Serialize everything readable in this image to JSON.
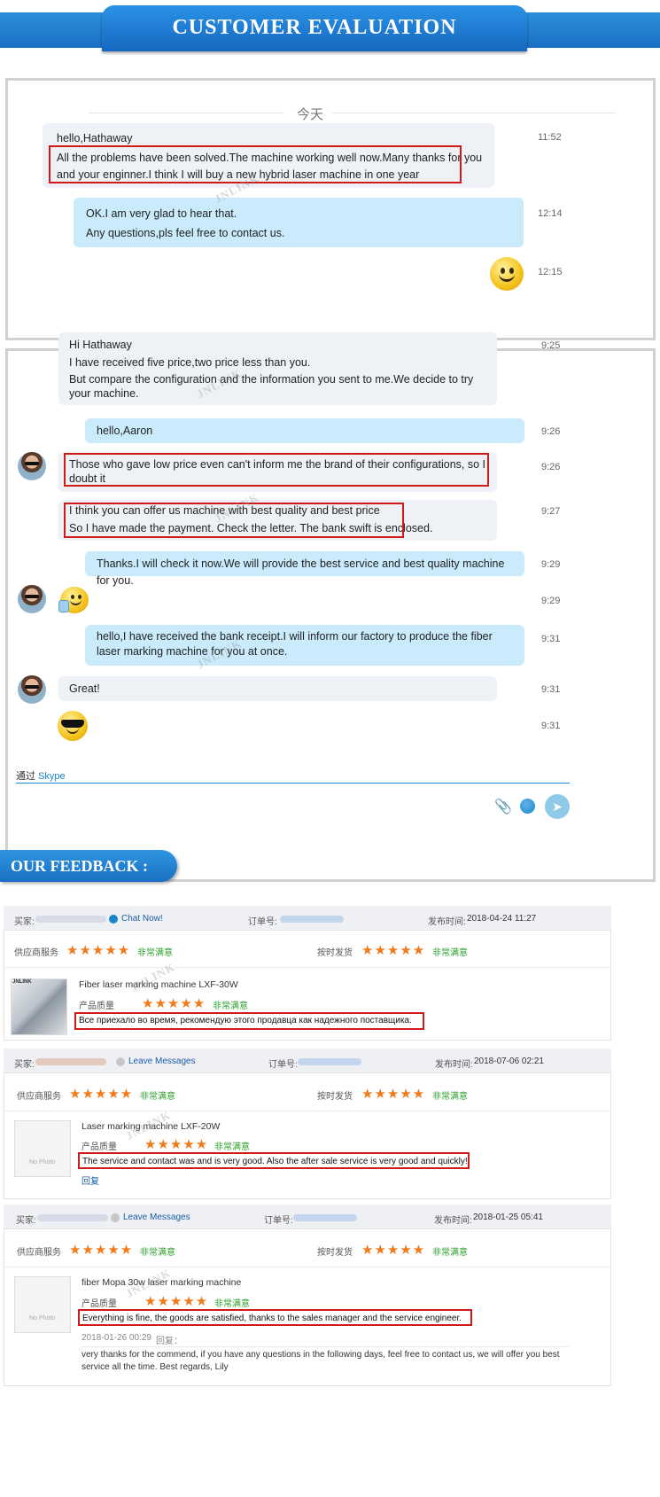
{
  "header": {
    "title": "CUSTOMER EVALUATION"
  },
  "chat1": {
    "date_divider": "今天",
    "messages": [
      {
        "side": "in",
        "lines": [
          "hello,Hathaway",
          "All the problems have been solved.The machine working well now.Many thanks for you and your enginner.I think I will buy a new hybrid laser machine in one year"
        ],
        "time": "11:52"
      },
      {
        "side": "out",
        "lines": [
          "OK.I am very glad to hear that.",
          "Any questions,pls feel free to contact us."
        ],
        "time": "12:14"
      },
      {
        "side": "in",
        "emoji": "smile-icon",
        "time": "12:15"
      }
    ]
  },
  "chat2": {
    "messages": [
      {
        "side": "in",
        "lines": [
          "Hi Hathaway",
          "I have received five price,two price less than you.",
          "But compare the configuration and the information you sent to me.We decide to try your machine."
        ],
        "time": "9:25"
      },
      {
        "side": "out",
        "lines": [
          "hello,Aaron"
        ],
        "time": "9:26"
      },
      {
        "side": "in",
        "lines": [
          "Those who gave low price even can't inform me the brand of their configurations, so I doubt it"
        ],
        "time": "9:26"
      },
      {
        "side": "in",
        "lines": [
          "I think you can offer us machine with best quality and best price",
          "So I have made the payment. Check the letter. The bank swift is enclosed."
        ],
        "time": "9:27"
      },
      {
        "side": "out",
        "lines": [
          "Thanks.I will check it now.We will provide the best service and best quality machine for you."
        ],
        "time": "9:29"
      },
      {
        "side": "in",
        "emoji": "thumbs-up-icon",
        "time": "9:29"
      },
      {
        "side": "out",
        "lines": [
          "hello,I have received the bank receipt.I will inform our factory to produce the fiber laser marking machine for you at once."
        ],
        "time": "9:31"
      },
      {
        "side": "in",
        "lines": [
          "Great!"
        ],
        "time": "9:31"
      },
      {
        "side": "in",
        "emoji": "sunglasses-icon",
        "time": "9:31"
      }
    ],
    "via_label": "通过",
    "via_link": "Skype"
  },
  "watermark": "JNLINK",
  "feedback": {
    "title": "OUR FEEDBACK :",
    "labels": {
      "buyer": "买家:",
      "order": "订单号:",
      "published": "发布时间:",
      "supplier_service": "供应商服务",
      "on_time": "按时发货",
      "quality": "产品质量",
      "satisfied": "非常满意",
      "reply": "回复",
      "reply_colon": "回复：",
      "no_photo": "No Photo",
      "chat_now": "Chat Now!",
      "leave_messages": "Leave Messages",
      "stars": "★★★★★",
      "logo": "JNLINK"
    },
    "reviews": [
      {
        "date": "2018-04-24 11:27",
        "product": "Fiber laser marking machine LXF-30W",
        "text": "Все приехало во время, рекомендую этого продавца как надежного поставщика."
      },
      {
        "date": "2018-07-06 02:21",
        "product": "Laser marking machine LXF-20W",
        "text": "The service and contact was and is very good. Also the after sale service is very good and quickly!"
      },
      {
        "date": "2018-01-25 05:41",
        "product": "fiber Mopa 30w laser marking machine",
        "text": "Everything is fine, the goods are satisfied, thanks to the sales manager and the service engineer.",
        "reply_date": "2018-01-26 00:29",
        "reply_text": "very thanks for the commend, if you have any questions in the following days, feel free to contact us, we will offer you best service all the time. Best regards, Lily"
      }
    ]
  },
  "colors": {
    "accent": "#1a6fc4",
    "highlight": "#d01a1a",
    "stars": "#f07a1a",
    "satisfied": "#2ca02c"
  }
}
